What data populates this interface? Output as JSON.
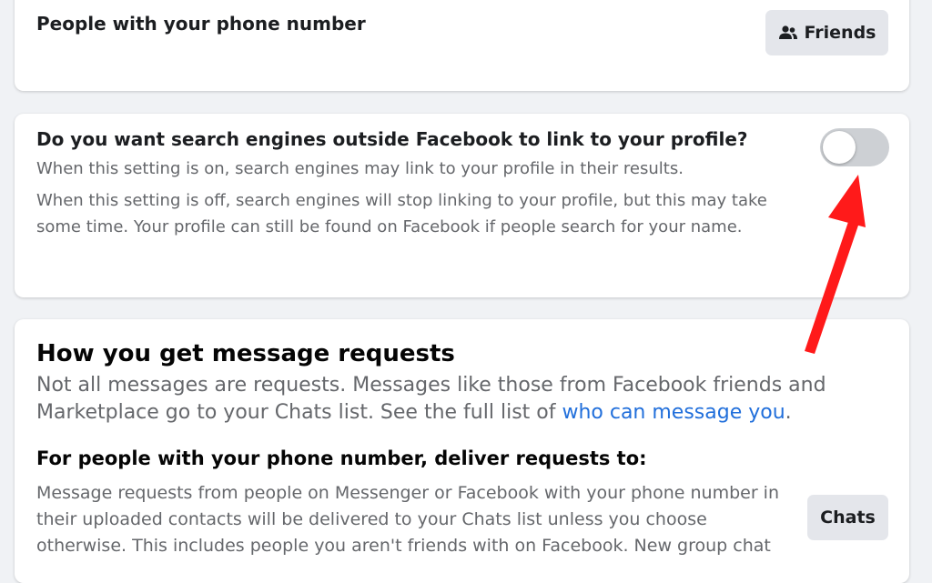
{
  "phone_lookup": {
    "title": "People with your phone number",
    "button_label": "Friends",
    "button_icon": "friends-icon"
  },
  "search_engines": {
    "title": "Do you want search engines outside Facebook to link to your profile?",
    "desc_on": "When this setting is on, search engines may link to your profile in their results.",
    "desc_off": "When this setting is off, search engines will stop linking to your profile, but this may take some time. Your profile can still be found on Facebook if people search for your name.",
    "toggle_on": false
  },
  "message_requests": {
    "title": "How you get message requests",
    "desc_prefix": "Not all messages are requests. Messages like those from Facebook friends and Marketplace go to your Chats list. See the full list of ",
    "desc_link": "who can message you",
    "desc_suffix": ".",
    "phone_title": "For people with your phone number, deliver requests to:",
    "phone_desc": "Message requests from people on Messenger or Facebook with your phone number in their uploaded contacts will be delivered to your Chats list unless you choose otherwise. This includes people you aren't friends with on Facebook. New group chat",
    "button_label": "Chats"
  },
  "colors": {
    "link": "#216fdb",
    "annotation_arrow": "#ff1a1a",
    "toggle_off": "#cdd0d4",
    "button_bg": "#e4e6eb"
  }
}
